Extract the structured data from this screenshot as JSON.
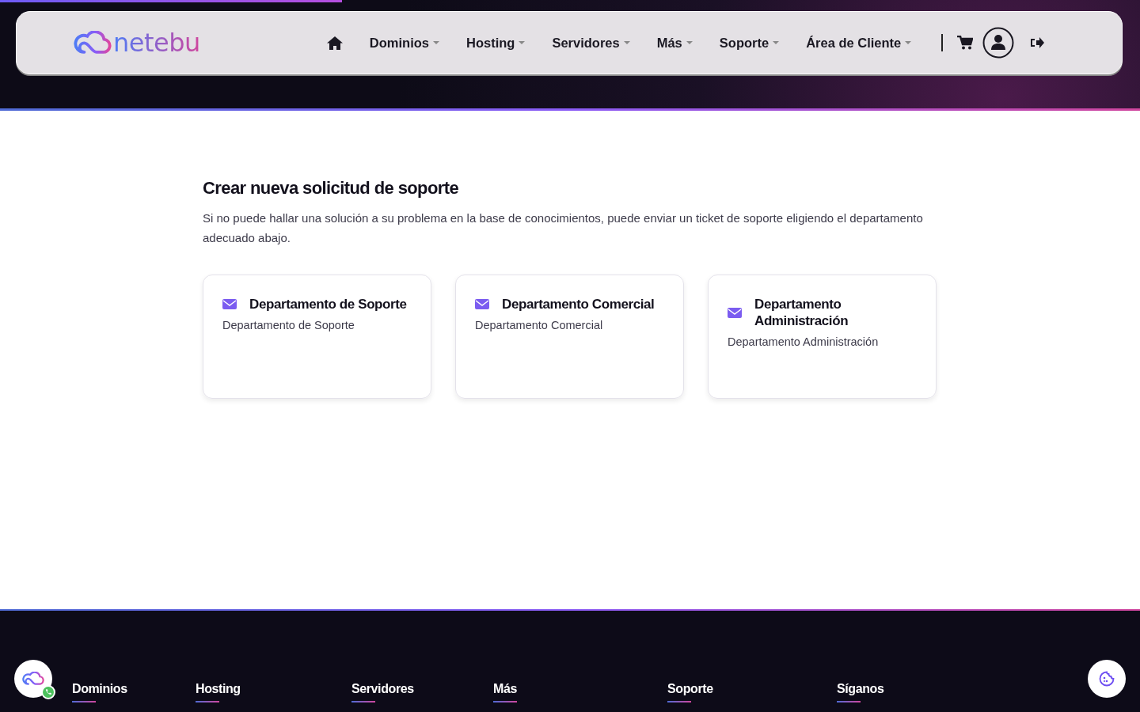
{
  "header": {
    "load_progress": {
      "level": 0.3
    },
    "logo": "netebu",
    "nav": [
      {
        "label": "Dominios",
        "dropdown": true
      },
      {
        "label": "Hosting",
        "dropdown": true
      },
      {
        "label": "Servidores",
        "dropdown": true
      },
      {
        "label": "Más",
        "dropdown": true
      },
      {
        "label": "Soporte",
        "dropdown": true
      },
      {
        "label": "Área de Cliente",
        "dropdown": true
      }
    ]
  },
  "main": {
    "title": "Crear nueva solicitud de soporte",
    "intro": "Si no puede hallar una solución a su problema en la base de conocimientos, puede enviar un ticket de soporte eligiendo el departamento adecuado abajo.",
    "departments": [
      {
        "name": "Departamento de Soporte",
        "description": "Departamento de Soporte"
      },
      {
        "name": "Departamento Comercial",
        "description": "Departamento Comercial"
      },
      {
        "name": "Departamento Administración",
        "description": "Departamento Administración"
      }
    ]
  },
  "footer": {
    "columns": [
      "Dominios",
      "Hosting",
      "Servidores",
      "Más",
      "Soporte",
      "Síganos"
    ]
  }
}
